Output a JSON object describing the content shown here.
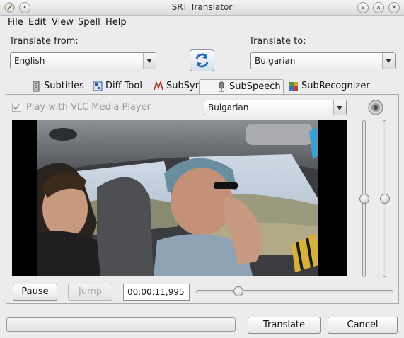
{
  "window": {
    "title": "SRT Translator"
  },
  "menu": {
    "items": [
      "File",
      "Edit",
      "View",
      "Spell",
      "Help"
    ]
  },
  "translate_from": {
    "label": "Translate from:",
    "value": "English"
  },
  "translate_to": {
    "label": "Translate to:",
    "value": "Bulgarian"
  },
  "tabs": [
    {
      "label": "Subtitles",
      "icon": "subtitles-icon"
    },
    {
      "label": "Diff Tool",
      "icon": "diff-tool-icon"
    },
    {
      "label": "SubSync",
      "icon": "subsync-icon"
    },
    {
      "label": "SubSpeech",
      "icon": "microphone-icon"
    },
    {
      "label": "SubRecognizer",
      "icon": "subrecognizer-icon"
    }
  ],
  "active_tab": "SubSpeech",
  "subspeech": {
    "play_vlc_label": "Play with VLC Media Player",
    "play_vlc_checked": true,
    "language_value": "Bulgarian",
    "pause_label": "Pause",
    "jump_label": "Jump",
    "time_value": "00:00:11,995",
    "seek_fraction": 0.2,
    "slider_left_fraction": 0.5,
    "slider_right_fraction": 0.5
  },
  "footer": {
    "translate_label": "Translate",
    "cancel_label": "Cancel",
    "progress_fraction": 0
  },
  "colors": {
    "accent": "#3a6fb0",
    "window_bg": "#ececec"
  }
}
